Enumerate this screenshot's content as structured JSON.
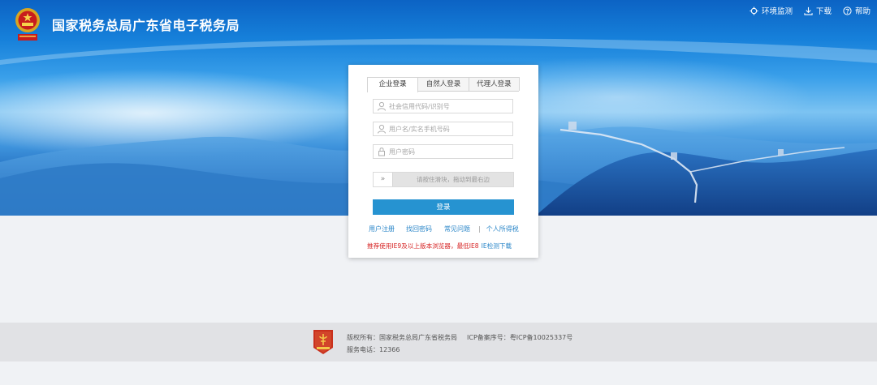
{
  "header": {
    "title": "国家税务总局广东省电子税务局",
    "emblem_icon": "national-emblem-icon",
    "links": [
      {
        "label": "环境监测",
        "icon": "monitor-icon"
      },
      {
        "label": "下载",
        "icon": "download-icon"
      },
      {
        "label": "帮助",
        "icon": "help-icon"
      }
    ]
  },
  "login": {
    "tabs": [
      "企业登录",
      "自然人登录",
      "代理人登录"
    ],
    "active_tab": "企业登录",
    "fields": {
      "credit_code": {
        "placeholder": "社会信用代码/识别号",
        "icon": "user-icon"
      },
      "username": {
        "placeholder": "用户名/实名手机号码",
        "icon": "user-icon"
      },
      "password": {
        "placeholder": "用户密码",
        "icon": "lock-icon"
      }
    },
    "slider": {
      "handle": "»",
      "text": "请按住滑块，拖动到最右边"
    },
    "submit_label": "登录",
    "links": {
      "register": "用户注册",
      "forgot": "找回密码",
      "faq": "常见问题",
      "separator": "|",
      "personal_tax": "个人所得税"
    },
    "notice": {
      "text": "推荐使用IE9及以上版本浏览器，最低IE8",
      "link": "IE检测下载"
    }
  },
  "footer": {
    "copyright": "版权所有：国家税务总局广东省税务局",
    "icp": "ICP备案序号：粤ICP备10025337号",
    "phone": "服务电话：12366",
    "badge_icon": "government-badge-icon"
  },
  "colors": {
    "brand_blue": "#1680da",
    "button_blue": "#2693d1",
    "link_blue": "#2a86c8",
    "notice_red": "#d62424"
  }
}
